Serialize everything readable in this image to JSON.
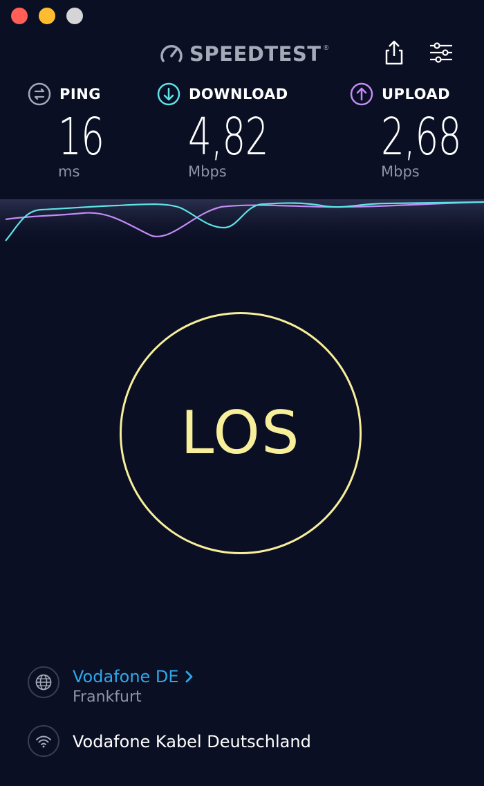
{
  "app": {
    "logo_text": "SPEEDTEST",
    "logo_mark": "®"
  },
  "window_controls": [
    "close",
    "minimize",
    "zoom"
  ],
  "toolbar": {
    "share_icon": "share-icon",
    "settings_icon": "settings-sliders-icon"
  },
  "metrics": {
    "ping": {
      "label": "PING",
      "value": "16",
      "unit": "ms",
      "icon": "ping-icon",
      "color": "#a6a9b8"
    },
    "download": {
      "label": "DOWNLOAD",
      "value": "4,82",
      "unit": "Mbps",
      "icon": "download-arrow-icon",
      "color": "#5ee3e6"
    },
    "upload": {
      "label": "UPLOAD",
      "value": "2,68",
      "unit": "Mbps",
      "icon": "upload-arrow-icon",
      "color": "#c28cf5"
    }
  },
  "graph": {
    "download_color": "#5ee3e6",
    "upload_color": "#c28cf5"
  },
  "go_button": {
    "label": "LOS",
    "color": "#f8ef9a"
  },
  "server": {
    "name": "Vodafone DE",
    "location": "Frankfurt",
    "icon": "globe-icon",
    "color": "#2ea8ea"
  },
  "isp": {
    "name": "Vodafone Kabel Deutschland",
    "icon": "wifi-icon"
  }
}
